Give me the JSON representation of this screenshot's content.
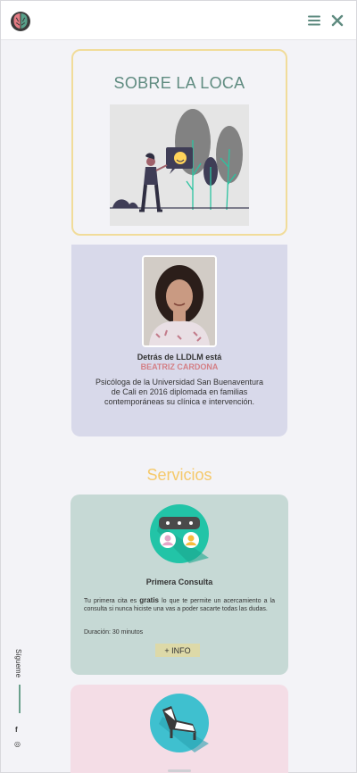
{
  "header": {
    "logo_icon": "brain-logo-icon",
    "menu_icon": "hamburger-menu-icon",
    "close_icon": "close-x-icon",
    "icon_color": "#5f8b80"
  },
  "side_social": {
    "label": "Sígueme",
    "facebook_glyph": "f",
    "instagram_glyph": "◎",
    "line_color": "#6aa08c"
  },
  "about": {
    "title": "SOBRE LA LOCA",
    "border_color": "#f1dc9a",
    "illustration_icon": "woman-with-chat-bubble-illustration"
  },
  "bio": {
    "lead": "Detrás de LLDLM está",
    "name": "BEATRIZ CARDONA",
    "description": "Psicóloga de la Universidad San Buenaventura de Cali en 2016 diplomada en familias contemporáneas su clínica e intervención.",
    "background": "#d8d9ea",
    "name_color": "#d47f85"
  },
  "services": {
    "title": "Servicios",
    "title_color": "#f5c96b",
    "items": [
      {
        "name": "Primera Consulta",
        "desc_pre": "Tu primera cita es ",
        "desc_bold": "gratis",
        "desc_post": " lo que te permite un acercamiento a la consulta si nunca hiciste una vas a poder sacarte todas las dudas.",
        "duration": "Duración: 30 minutos",
        "button_label": "+ INFO",
        "icon": "chat-people-icon",
        "background": "#c6d9d5"
      },
      {
        "icon": "couch-therapy-icon",
        "background": "#f4dde6"
      }
    ]
  }
}
